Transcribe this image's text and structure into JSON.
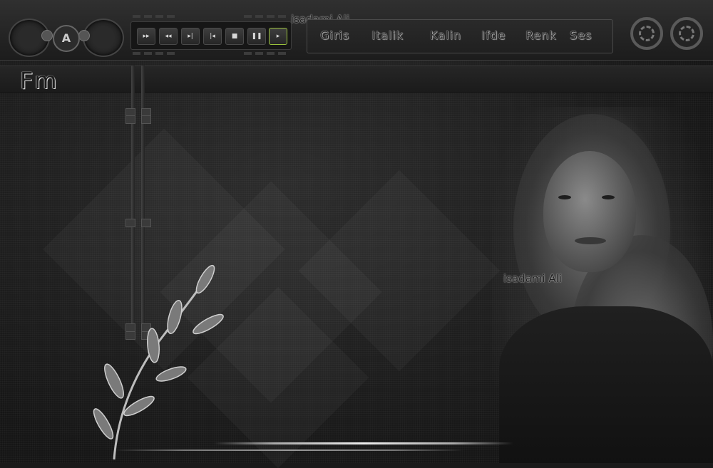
{
  "app": {
    "watermark_top": "isadami Ali",
    "watermark_mid": "isadami Ali",
    "fm_logo": "Fm",
    "logo_letter": "A"
  },
  "transport": {
    "buttons": [
      {
        "icon": "fast-forward-icon",
        "glyph": "▸▸"
      },
      {
        "icon": "rewind-icon",
        "glyph": "◂◂"
      },
      {
        "icon": "next-track-icon",
        "glyph": "▸|"
      },
      {
        "icon": "previous-track-icon",
        "glyph": "|◂"
      },
      {
        "icon": "stop-icon",
        "glyph": "■"
      },
      {
        "icon": "pause-icon",
        "glyph": "❚❚"
      },
      {
        "icon": "play-icon",
        "glyph": "▸"
      }
    ],
    "active_index": 6,
    "active_color": "#9ac23c"
  },
  "menu": {
    "items": [
      "Giris",
      "Italik",
      "Kalin",
      "Ifde",
      "Renk",
      "Ses"
    ]
  },
  "colors": {
    "background": "#1a1a1a",
    "accent": "#9ac23c"
  }
}
